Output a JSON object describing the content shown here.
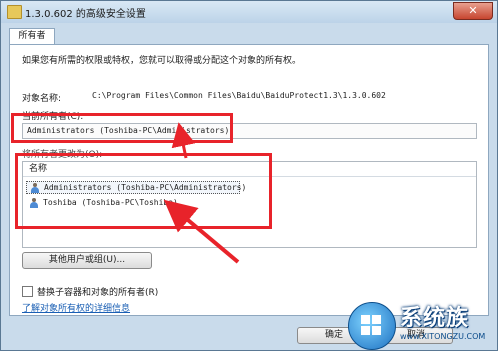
{
  "window": {
    "title": "1.3.0.602 的高级安全设置",
    "close_glyph": "✕"
  },
  "tabs": [
    {
      "label": "所有者"
    }
  ],
  "owner_tab": {
    "description": "如果您有所需的权限或特权，您就可以取得或分配这个对象的所有权。",
    "object_name_label": "对象名称:",
    "object_name_value": "C:\\Program Files\\Common Files\\Baidu\\BaiduProtect1.3\\1.3.0.602",
    "current_owner_label": "当前所有者(C):",
    "current_owner_value": "Administrators (Toshiba-PC\\Administrators)",
    "change_owner_label": "将所有者更改为(O):",
    "list": {
      "column_name": "名称",
      "rows": [
        {
          "label": "Administrators (Toshiba-PC\\Administrators)",
          "selected": true,
          "icon": "user-group-icon"
        },
        {
          "label": "Toshiba (Toshiba-PC\\Toshiba)",
          "selected": false,
          "icon": "user-icon"
        }
      ]
    },
    "other_users_button": "其他用户或组(U)...",
    "replace_checkbox_label": "替换子容器和对象的所有者(R)",
    "replace_checked": false,
    "help_link": "了解对象所有权的详细信息"
  },
  "buttons": {
    "ok": "确定",
    "cancel": "取消"
  },
  "watermark": {
    "brand": "系统族",
    "url": "www.XITONGZU.COM"
  },
  "colors": {
    "annotation": "#e8232a",
    "link": "#1a5fb4"
  }
}
